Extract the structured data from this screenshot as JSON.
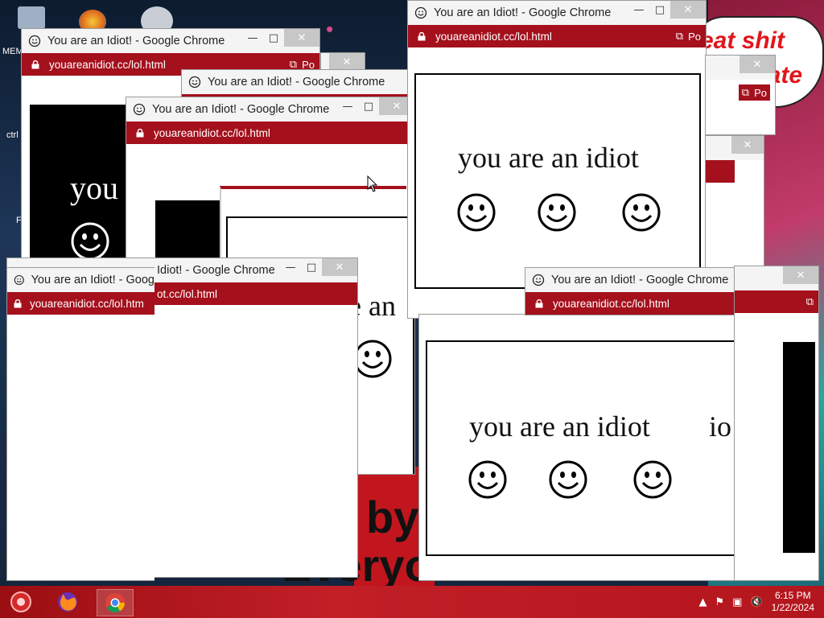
{
  "window": {
    "title": "You are an Idiot! - Google Chrome",
    "title_partial_left": "You are an Idiot! - Goog",
    "title_partial_right": "Idiot! - Google Chrome",
    "url": "youareanidiot.cc/lol.html",
    "url_partial_left": "youareanidiot.cc/lol.htm",
    "url_partial_right": "ot.cc/lol.html",
    "popup_label": "Po",
    "message": "you are an idiot",
    "message_partial": "you",
    "message_fragment_a": "e an",
    "message_fragment_b": "io",
    "btn_min": "—",
    "btn_max": "□",
    "btn_close": "✕"
  },
  "desktop": {
    "icons": [
      "MEM",
      "ctrl",
      "F"
    ],
    "background_text": [
      "eat shit",
      "rate",
      "by 2",
      "Everyo"
    ]
  },
  "taskbar": {
    "time": "6:15 PM",
    "date": "1/22/2024",
    "apps": [
      "start-orb",
      "firefox",
      "chrome"
    ]
  },
  "colors": {
    "accent_red": "#a4101c",
    "taskbar_red": "#c21f27",
    "titlebar": "#f4f4f4"
  }
}
